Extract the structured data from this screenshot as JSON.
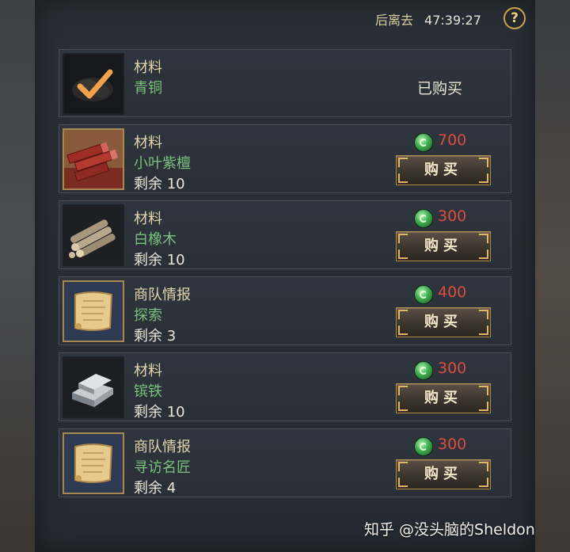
{
  "header": {
    "timer_label": "后离去",
    "timer_value": "47:39:27",
    "help_glyph": "?"
  },
  "items": [
    {
      "category": "材料",
      "name": "青铜",
      "status": "已购买",
      "icon": "bronze-ore-check-icon"
    },
    {
      "category": "材料",
      "name": "小叶紫檀",
      "remaining": "剩余 10",
      "price": "700",
      "buy_label": "购买",
      "icon": "red-sandalwood-icon"
    },
    {
      "category": "材料",
      "name": "白橡木",
      "remaining": "剩余 10",
      "price": "300",
      "buy_label": "购买",
      "icon": "white-oak-logs-icon"
    },
    {
      "category": "商队情报",
      "name": "探索",
      "remaining": "剩余 3",
      "price": "400",
      "buy_label": "购买",
      "icon": "scroll-icon"
    },
    {
      "category": "材料",
      "name": "镔铁",
      "remaining": "剩余 10",
      "price": "300",
      "buy_label": "购买",
      "icon": "iron-ingot-icon"
    },
    {
      "category": "商队情报",
      "name": "寻访名匠",
      "remaining": "剩余 4",
      "price": "300",
      "buy_label": "购买",
      "icon": "scroll-icon"
    }
  ],
  "watermark": "知乎 @没头脑的Sheldon",
  "colors": {
    "category": "#e2d6ac",
    "item_name": "#7bc17d",
    "price": "#df4b40",
    "button_border": "#b48a4a",
    "currency": "#3fae4c"
  }
}
